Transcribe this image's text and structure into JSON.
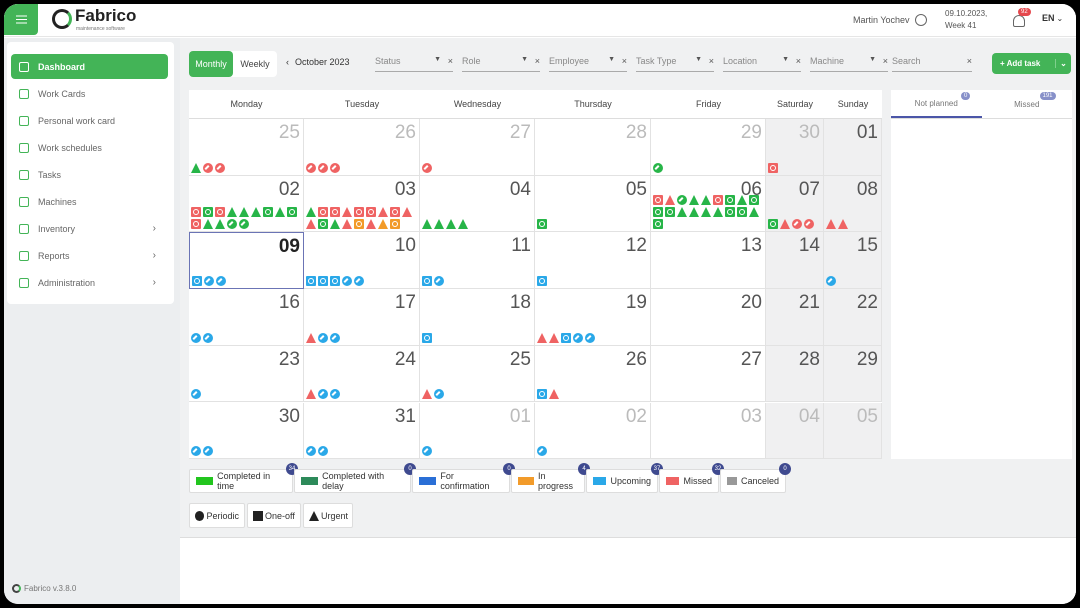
{
  "app": {
    "name": "Fabrico",
    "tagline": "maintenance software",
    "version": "Fabrico v.3.8.0"
  },
  "topbar": {
    "user": "Martin Yochev",
    "date": "09.10.2023,",
    "week": "Week 41",
    "notifications": "92",
    "language": "EN"
  },
  "sidebar": {
    "items": [
      {
        "label": "Dashboard",
        "icon": "dashboard-icon",
        "active": true
      },
      {
        "label": "Work Cards",
        "icon": "layers-icon"
      },
      {
        "label": "Personal work card",
        "icon": "id-card-icon"
      },
      {
        "label": "Work schedules",
        "icon": "calendar-list-icon"
      },
      {
        "label": "Tasks",
        "icon": "tasks-icon"
      },
      {
        "label": "Machines",
        "icon": "machine-icon"
      },
      {
        "label": "Inventory",
        "icon": "box-icon",
        "chevron": true
      },
      {
        "label": "Reports",
        "icon": "pie-chart-icon",
        "chevron": true
      },
      {
        "label": "Administration",
        "icon": "sliders-icon",
        "chevron": true
      }
    ]
  },
  "toolbar": {
    "view_monthly": "Monthly",
    "view_weekly": "Weekly",
    "period": "October 2023",
    "filters": [
      "Status",
      "Role",
      "Employee",
      "Task Type",
      "Location",
      "Machine"
    ],
    "search_placeholder": "Search",
    "add_task": "+ Add task"
  },
  "calendar": {
    "weekdays": [
      "Monday",
      "Tuesday",
      "Wednesday",
      "Thursday",
      "Friday",
      "Saturday",
      "Sunday"
    ],
    "weeks": [
      [
        {
          "d": "25",
          "f": true,
          "t": "gT rC rC"
        },
        {
          "d": "26",
          "f": true,
          "t": "rC rC rC"
        },
        {
          "d": "27",
          "f": true,
          "t": "rC"
        },
        {
          "d": "28",
          "f": true,
          "t": ""
        },
        {
          "d": "29",
          "f": true,
          "t": "gC"
        },
        {
          "d": "30",
          "f": true,
          "t": "rS"
        },
        {
          "d": "01",
          "t": ""
        }
      ],
      [
        {
          "d": "02",
          "t": "rS gS rS gT gT gT gS gT gS rS gT gT gC gC"
        },
        {
          "d": "03",
          "t": "gT rS rS rT rS rS rT rS rT rT gS gT rT oS rT oT oS"
        },
        {
          "d": "04",
          "t": "gT gT gT gT"
        },
        {
          "d": "05",
          "t": "gS"
        },
        {
          "d": "06",
          "t": "rS rT gC gT gT rS gS gT gS gS gS gT gT gT gT gS gS gT gS"
        },
        {
          "d": "07",
          "t": "gS rT rC rC"
        },
        {
          "d": "08",
          "t": "rT rT"
        }
      ],
      [
        {
          "d": "09",
          "today": true,
          "t": "bS bC bC"
        },
        {
          "d": "10",
          "t": "bS bS bS bC bC"
        },
        {
          "d": "11",
          "t": "bS bC"
        },
        {
          "d": "12",
          "t": "bS"
        },
        {
          "d": "13",
          "t": ""
        },
        {
          "d": "14",
          "t": ""
        },
        {
          "d": "15",
          "t": "bC"
        }
      ],
      [
        {
          "d": "16",
          "t": "bC bC"
        },
        {
          "d": "17",
          "t": "rT bC bC"
        },
        {
          "d": "18",
          "t": "bS"
        },
        {
          "d": "19",
          "t": "rT rT bS bC bC"
        },
        {
          "d": "20",
          "t": ""
        },
        {
          "d": "21",
          "t": ""
        },
        {
          "d": "22",
          "t": ""
        }
      ],
      [
        {
          "d": "23",
          "t": "bC"
        },
        {
          "d": "24",
          "t": "rT bC bC"
        },
        {
          "d": "25",
          "t": "rT bC"
        },
        {
          "d": "26",
          "t": "bS rT"
        },
        {
          "d": "27",
          "t": ""
        },
        {
          "d": "28",
          "t": ""
        },
        {
          "d": "29",
          "t": ""
        }
      ],
      [
        {
          "d": "30",
          "t": "bC bC"
        },
        {
          "d": "31",
          "t": "bC bC"
        },
        {
          "d": "01",
          "f": true,
          "t": "bC"
        },
        {
          "d": "02",
          "f": true,
          "t": "bC"
        },
        {
          "d": "03",
          "f": true,
          "t": ""
        },
        {
          "d": "04",
          "f": true,
          "t": ""
        },
        {
          "d": "05",
          "f": true,
          "t": ""
        }
      ]
    ]
  },
  "right_panel": {
    "tabs": [
      {
        "label": "Not planned",
        "count": "0"
      },
      {
        "label": "Missed",
        "count": "191"
      }
    ]
  },
  "legend": [
    {
      "label": "Completed in time",
      "count": "34",
      "color": "#22c51e"
    },
    {
      "label": "Completed with delay",
      "count": "0",
      "color": "#2d8a5a"
    },
    {
      "label": "For confirmation",
      "count": "0",
      "color": "#2a6fd6"
    },
    {
      "label": "In progress",
      "count": "4",
      "color": "#f29b2a"
    },
    {
      "label": "Upcoming",
      "count": "37",
      "color": "#2aa8e8"
    },
    {
      "label": "Missed",
      "count": "32",
      "color": "#ef6363"
    },
    {
      "label": "Canceled",
      "count": "0",
      "color": "#999999"
    }
  ],
  "task_types": [
    {
      "label": "Periodic",
      "icon": "periodic-icon"
    },
    {
      "label": "One-off",
      "icon": "one-off-icon"
    },
    {
      "label": "Urgent",
      "icon": "urgent-icon"
    }
  ],
  "colors": {
    "g": "#27b548",
    "r": "#ef6363",
    "b": "#2aa8e8",
    "o": "#f29b2a",
    "accent": "#43b457"
  }
}
